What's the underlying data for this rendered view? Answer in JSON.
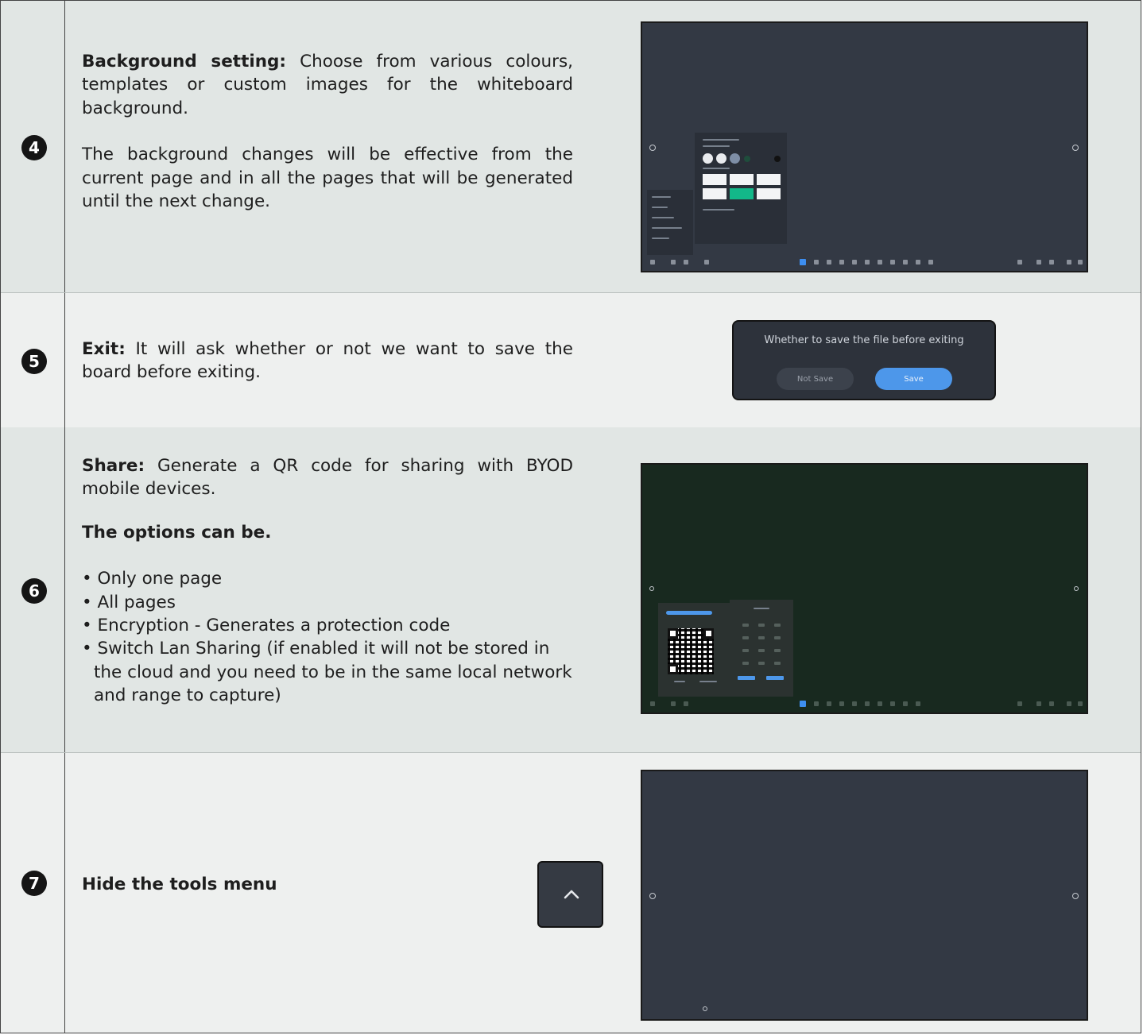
{
  "rows": [
    {
      "number": "4",
      "heading": "Background setting:",
      "paragraph1_rest": " Choose from various colours, templates or custom images for the whiteboard background.",
      "paragraph2": "The background changes will be effective from the current page and in all the pages that will be generated until the next change."
    },
    {
      "number": "5",
      "heading": "Exit:",
      "paragraph1_rest": " It will ask whether or not we want to save the board before exiting.",
      "dialog": {
        "message": "Whether to save the file before exiting",
        "secondary_label": "Not Save",
        "primary_label": "Save"
      }
    },
    {
      "number": "6",
      "heading": "Share:",
      "paragraph1_rest": " Generate a QR code for sharing with BYOD mobile devices.",
      "options_heading": "The options can be.",
      "options": [
        "• Only one page",
        "• All pages",
        "• Encryption - Generates a protection code",
        "• Switch Lan Sharing (if enabled it will not be stored in the cloud and you need to be in the same local network and range to capture)"
      ]
    },
    {
      "number": "7",
      "heading": "Hide the tools menu"
    }
  ],
  "colors": {
    "row_dark": "#e1e6e4",
    "row_light": "#eef0ef",
    "screen_grey": "#333944",
    "screen_green": "#18291f",
    "accent_blue": "#4d97ea",
    "template_green": "#13b889"
  },
  "icons": [
    "chevron-up-icon"
  ]
}
